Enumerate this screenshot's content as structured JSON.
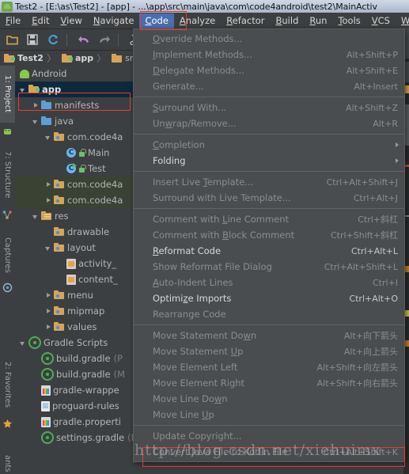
{
  "window": {
    "title": "Test2 - [E:\\as\\Test2] - [app] - ...\\app\\src\\main\\java\\com\\code4android\\test2\\MainActiv",
    "app_icon": "android-studio-icon"
  },
  "menubar": {
    "items": [
      {
        "label": "File",
        "mnemonic": "F",
        "active": false
      },
      {
        "label": "Edit",
        "mnemonic": "E",
        "active": false
      },
      {
        "label": "View",
        "mnemonic": "V",
        "active": false
      },
      {
        "label": "Navigate",
        "mnemonic": "N",
        "active": false
      },
      {
        "label": "Code",
        "mnemonic": "C",
        "active": true
      },
      {
        "label": "Analyze",
        "mnemonic": "A",
        "active": false
      },
      {
        "label": "Refactor",
        "mnemonic": "R",
        "active": false
      },
      {
        "label": "Build",
        "mnemonic": "B",
        "active": false
      },
      {
        "label": "Run",
        "mnemonic": "R",
        "active": false
      },
      {
        "label": "Tools",
        "mnemonic": "T",
        "active": false
      },
      {
        "label": "VCS",
        "mnemonic": "V",
        "active": false
      },
      {
        "label": "Wind",
        "mnemonic": "W",
        "active": false
      }
    ]
  },
  "toolbar": {
    "buttons": [
      {
        "name": "open-folder-icon",
        "glyph": "folder"
      },
      {
        "name": "save-all-icon",
        "glyph": "save"
      },
      {
        "name": "sync-icon",
        "glyph": "sync"
      },
      {
        "name": "undo-icon",
        "glyph": "undo"
      },
      {
        "name": "redo-icon",
        "glyph": "redo"
      },
      {
        "name": "cut-icon",
        "glyph": "cut"
      }
    ]
  },
  "breadcrumb": {
    "items": [
      {
        "label": "Test2",
        "icon": "module-folder-icon",
        "bold": true
      },
      {
        "label": "app",
        "icon": "module-folder-icon",
        "bold": true
      },
      {
        "label": "src",
        "icon": "folder-icon",
        "bold": false
      }
    ],
    "separator": "〉"
  },
  "toolwindow_tabs": [
    {
      "label": "1: Project",
      "icon": "android-icon",
      "selected": true
    },
    {
      "label": "7: Structure",
      "icon": "structure-icon",
      "selected": false
    },
    {
      "label": "Captures",
      "icon": "captures-icon",
      "selected": false
    },
    {
      "label": "2: Favorites",
      "icon": "star-icon",
      "selected": false
    },
    {
      "label": "ants",
      "icon": "none",
      "selected": false
    }
  ],
  "project_tree": {
    "view_label": "Android",
    "nodes": [
      {
        "label": "app",
        "indent": 0,
        "arrow": "down",
        "icon": "module-folder-icon",
        "bold": true,
        "selected": true,
        "suffix": ""
      },
      {
        "label": "manifests",
        "indent": 1,
        "arrow": "right",
        "icon": "folder-blue-icon",
        "bold": false,
        "selected": false,
        "suffix": ""
      },
      {
        "label": "java",
        "indent": 1,
        "arrow": "down",
        "icon": "folder-blue-icon",
        "bold": false,
        "selected": false,
        "suffix": ""
      },
      {
        "label": "com.code4a",
        "indent": 2,
        "arrow": "down",
        "icon": "package-folder-icon",
        "bold": false,
        "selected": false,
        "suffix": ""
      },
      {
        "label": "Main",
        "indent": 3,
        "arrow": "none",
        "icon": "java-class-icon",
        "bold": false,
        "selected": false,
        "suffix": ""
      },
      {
        "label": "Test",
        "indent": 3,
        "arrow": "none",
        "icon": "java-class-runnable-icon",
        "bold": false,
        "selected": false,
        "suffix": ""
      },
      {
        "label": "com.code4a",
        "indent": 2,
        "arrow": "right",
        "icon": "package-folder-icon",
        "bold": false,
        "selected": false,
        "green": true,
        "suffix": ""
      },
      {
        "label": "com.code4a",
        "indent": 2,
        "arrow": "right",
        "icon": "package-folder-icon",
        "bold": false,
        "selected": false,
        "green": true,
        "suffix": ""
      },
      {
        "label": "res",
        "indent": 1,
        "arrow": "down",
        "icon": "res-folder-icon",
        "bold": false,
        "selected": false,
        "suffix": ""
      },
      {
        "label": "drawable",
        "indent": 2,
        "arrow": "none",
        "icon": "package-folder-icon",
        "bold": false,
        "selected": false,
        "suffix": ""
      },
      {
        "label": "layout",
        "indent": 2,
        "arrow": "down",
        "icon": "package-folder-icon",
        "bold": false,
        "selected": false,
        "suffix": ""
      },
      {
        "label": "activity_",
        "indent": 3,
        "arrow": "none",
        "icon": "xml-layout-icon",
        "bold": false,
        "selected": false,
        "suffix": ""
      },
      {
        "label": "content_",
        "indent": 3,
        "arrow": "none",
        "icon": "xml-layout-icon",
        "bold": false,
        "selected": false,
        "suffix": ""
      },
      {
        "label": "menu",
        "indent": 2,
        "arrow": "right",
        "icon": "package-folder-icon",
        "bold": false,
        "selected": false,
        "suffix": ""
      },
      {
        "label": "mipmap",
        "indent": 2,
        "arrow": "right",
        "icon": "package-folder-icon",
        "bold": false,
        "selected": false,
        "suffix": ""
      },
      {
        "label": "values",
        "indent": 2,
        "arrow": "right",
        "icon": "package-folder-icon",
        "bold": false,
        "selected": false,
        "suffix": ""
      },
      {
        "label": "Gradle Scripts",
        "indent": 0,
        "arrow": "down",
        "icon": "gradle-icon",
        "bold": false,
        "selected": false,
        "suffix": ""
      },
      {
        "label": "build.gradle",
        "indent": 1,
        "arrow": "none",
        "icon": "gradle-icon",
        "bold": false,
        "selected": false,
        "suffix": "(P"
      },
      {
        "label": "build.gradle",
        "indent": 1,
        "arrow": "none",
        "icon": "gradle-icon",
        "bold": false,
        "selected": false,
        "suffix": "(M"
      },
      {
        "label": "gradle-wrappe",
        "indent": 1,
        "arrow": "none",
        "icon": "properties-icon",
        "bold": false,
        "selected": false,
        "suffix": ""
      },
      {
        "label": "proguard-rules",
        "indent": 1,
        "arrow": "none",
        "icon": "text-file-icon",
        "bold": false,
        "selected": false,
        "suffix": ""
      },
      {
        "label": "gradle.properti",
        "indent": 1,
        "arrow": "none",
        "icon": "properties-icon",
        "bold": false,
        "selected": false,
        "suffix": ""
      },
      {
        "label": "settings.gradle",
        "indent": 1,
        "arrow": "none",
        "icon": "gradle-icon",
        "bold": false,
        "selected": false,
        "suffix": "(Project Settings)"
      }
    ]
  },
  "code_menu": {
    "groups": [
      [
        {
          "label": "Override Methods...",
          "mnemonic": "O",
          "shortcut": "",
          "enabled": false,
          "submenu": false
        },
        {
          "label": "Implement Methods...",
          "mnemonic": "I",
          "shortcut": "Alt+Shift+P",
          "enabled": false,
          "submenu": false
        },
        {
          "label": "Delegate Methods...",
          "mnemonic": "D",
          "shortcut": "Alt+Shift+E",
          "enabled": false,
          "submenu": false
        },
        {
          "label": "Generate...",
          "mnemonic": "",
          "shortcut": "Alt+Insert",
          "enabled": false,
          "submenu": false
        }
      ],
      [
        {
          "label": "Surround With...",
          "mnemonic": "S",
          "shortcut": "Alt+Shift+Z",
          "enabled": false,
          "submenu": false
        },
        {
          "label": "Unwrap/Remove...",
          "mnemonic": "w",
          "shortcut": "Alt+R",
          "enabled": false,
          "submenu": false
        }
      ],
      [
        {
          "label": "Completion",
          "mnemonic": "C",
          "shortcut": "",
          "enabled": false,
          "submenu": true
        },
        {
          "label": "Folding",
          "mnemonic": "",
          "shortcut": "",
          "enabled": true,
          "submenu": true
        }
      ],
      [
        {
          "label": "Insert Live Template...",
          "mnemonic": "T",
          "shortcut": "Ctrl+Alt+Shift+J",
          "enabled": false,
          "submenu": false
        },
        {
          "label": "Surround with Live Template...",
          "mnemonic": "",
          "shortcut": "Ctrl+Alt+J",
          "enabled": false,
          "submenu": false
        }
      ],
      [
        {
          "label": "Comment with Line Comment",
          "mnemonic": "L",
          "shortcut": "Ctrl+斜杠",
          "enabled": false,
          "submenu": false
        },
        {
          "label": "Comment with Block Comment",
          "mnemonic": "B",
          "shortcut": "Ctrl+Shift+斜杠",
          "enabled": false,
          "submenu": false
        },
        {
          "label": "Reformat Code",
          "mnemonic": "R",
          "shortcut": "Ctrl+Alt+L",
          "enabled": true,
          "submenu": false
        },
        {
          "label": "Show Reformat File Dialog",
          "mnemonic": "",
          "shortcut": "Ctrl+Alt+Shift+L",
          "enabled": false,
          "submenu": false
        },
        {
          "label": "Auto-Indent Lines",
          "mnemonic": "A",
          "shortcut": "Ctrl+I",
          "enabled": false,
          "submenu": false
        },
        {
          "label": "Optimize Imports",
          "mnemonic": "z",
          "shortcut": "Ctrl+Alt+O",
          "enabled": true,
          "submenu": false
        },
        {
          "label": "Rearrange Code",
          "mnemonic": "",
          "shortcut": "",
          "enabled": false,
          "submenu": false
        }
      ],
      [
        {
          "label": "Move Statement Down",
          "mnemonic": "w",
          "shortcut": "Alt+向下箭头",
          "enabled": false,
          "submenu": false
        },
        {
          "label": "Move Statement Up",
          "mnemonic": "U",
          "shortcut": "Alt+向上箭头",
          "enabled": false,
          "submenu": false
        },
        {
          "label": "Move Element Left",
          "mnemonic": "",
          "shortcut": "Alt+Shift+向左箭头",
          "enabled": false,
          "submenu": false
        },
        {
          "label": "Move Element Right",
          "mnemonic": "",
          "shortcut": "Alt+Shift+向右箭头",
          "enabled": false,
          "submenu": false
        },
        {
          "label": "Move Line Down",
          "mnemonic": "w",
          "shortcut": "",
          "enabled": false,
          "submenu": false
        },
        {
          "label": "Move Line Up",
          "mnemonic": "U",
          "shortcut": "",
          "enabled": false,
          "submenu": false
        }
      ],
      [
        {
          "label": "Update Copyright...",
          "mnemonic": "",
          "shortcut": "",
          "enabled": false,
          "submenu": false
        },
        {
          "label": "Convert Java File to Kotlin File",
          "mnemonic": "",
          "shortcut": "Ctrl+Alt+Shift+K",
          "enabled": false,
          "submenu": false
        }
      ]
    ]
  },
  "watermark": {
    "text": "http://blog.csdn.net/xiehuimx"
  },
  "colors": {
    "background": "#3c3f41",
    "menu_background": "#4a4d4f",
    "accent_blue": "#4b6eaf",
    "annotation_red": "#e83b2e",
    "selection_navy": "#0d293e",
    "folder_orange": "#d6a459",
    "folder_blue": "#5d9fd6",
    "gradle_green": "#4caf50"
  }
}
